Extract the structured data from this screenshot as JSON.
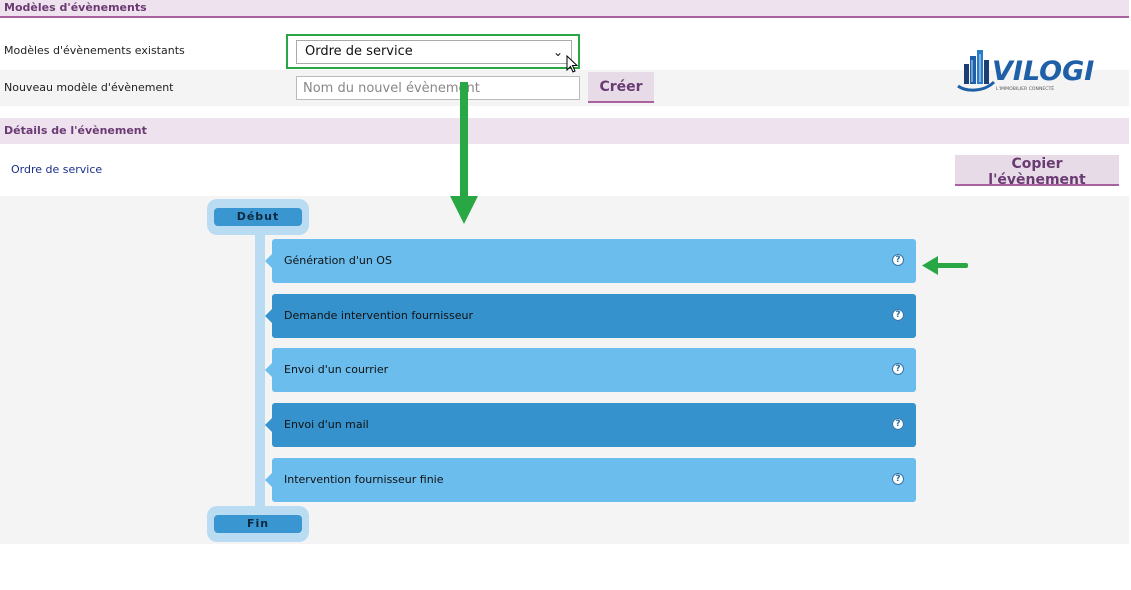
{
  "headers": {
    "models": "Modèles d'évènements",
    "details": "Détails de l'évènement"
  },
  "form": {
    "existing_label": "Modèles d'évènements existants",
    "existing_value": "Ordre de service",
    "new_label": "Nouveau modèle d'évènement",
    "new_placeholder": "Nom du nouvel évènement",
    "create_button": "Créer"
  },
  "logo": {
    "text": "VILOGI",
    "tagline": "L'IMMOBILIER CONNECTÉ"
  },
  "details": {
    "event_name": "Ordre de service",
    "copy_button": "Copier l'évènement"
  },
  "flow": {
    "start": "Début",
    "end": "Fin",
    "steps": [
      {
        "label": "Génération d'un OS"
      },
      {
        "label": "Demande intervention fournisseur"
      },
      {
        "label": "Envoi d'un courrier"
      },
      {
        "label": "Envoi d'un mail"
      },
      {
        "label": "Intervention fournisseur finie"
      }
    ],
    "help_glyph": "?"
  },
  "colors": {
    "accent": "#a9619f",
    "header_bg": "#eee2ef",
    "step_light": "#6bbdee",
    "step_dark": "#3692cc",
    "annotation": "#29a745"
  },
  "icons": {
    "select_chevron": "chevron-down-icon",
    "help": "help-icon",
    "pointer": "mouse-cursor-icon"
  }
}
